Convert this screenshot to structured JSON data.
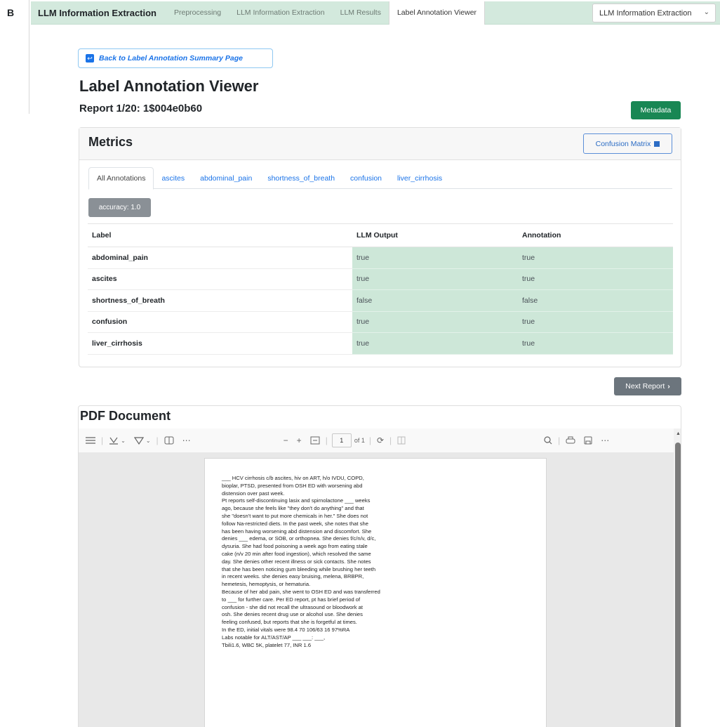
{
  "figure_label": "B",
  "nav": {
    "brand": "LLM Information Extraction",
    "tabs": [
      "Preprocessing",
      "LLM Information Extraction",
      "LLM Results",
      "Label Annotation Viewer"
    ],
    "active_tab": "Label Annotation Viewer",
    "select_value": "LLM Information Extraction"
  },
  "back_button": "Back to Label Annotation Summary Page",
  "page_title": "Label Annotation Viewer",
  "report_line": "Report 1/20: 1$004e0b60",
  "metadata_button": "Metadata",
  "metrics": {
    "title": "Metrics",
    "confusion_button": "Confusion Matrix",
    "tabs": [
      "All Annotations",
      "ascites",
      "abdominal_pain",
      "shortness_of_breath",
      "confusion",
      "liver_cirrhosis"
    ],
    "accuracy": "accuracy: 1.0",
    "columns": [
      "Label",
      "LLM Output",
      "Annotation"
    ],
    "rows": [
      {
        "label": "abdominal_pain",
        "llm": "true",
        "annotation": "true"
      },
      {
        "label": "ascites",
        "llm": "true",
        "annotation": "true"
      },
      {
        "label": "shortness_of_breath",
        "llm": "false",
        "annotation": "false"
      },
      {
        "label": "confusion",
        "llm": "true",
        "annotation": "true"
      },
      {
        "label": "liver_cirrhosis",
        "llm": "true",
        "annotation": "true"
      }
    ]
  },
  "next_button": "Next Report",
  "pdf": {
    "title": "PDF Document",
    "page_number": "1",
    "page_of": "of 1",
    "lines": [
      "___ HCV cirrhosis c/b ascites, hiv on ART, h/o IVDU, COPD,",
      "bioplar, PTSD, presented from OSH ED with worsening abd",
      "distension over past week.",
      "Pt reports self-discontinuing lasix and spirnolactone ___ weeks",
      "ago, because she feels like \"they don't do anything\" and that",
      "she \"doesn't want to put more chemicals in her.\" She does not",
      "follow Na-restricted diets. In the past week, she notes that she",
      "has been having worsening abd distension and discomfort. She",
      "denies ___ edema, or SOB, or orthopnea. She denies f/c/n/v, d/c,",
      "dysuria. She had food poisoning a week ago from eating stale",
      "cake (n/v 20 min after food ingestion), which resolved the same",
      "day. She denies other recent illness or sick contacts. She notes",
      "that she has been noticing gum bleeding while brushing her teeth",
      "in recent weeks. she denies easy bruising, melena, BRBPR,",
      "hemetesis, hemoptysis, or hematuria.",
      "Because of her abd pain, she went to OSH ED and was transferred",
      "to ___ for further care. Per ED report, pt has brief period of",
      "confusion - she did not recall the ultrasound or bloodwork at",
      "osh. She denies recent drug use or alcohol use. She denies",
      "feeling confused, but reports that she is forgetful at times.",
      "In the ED, initial vitals were 98.4 70 106/63 16 97%RA",
      "Labs notable for ALT/AST/AP ___ ___: ___,",
      "Tbili1.6, WBC 5K, platelet 77, INR 1.6"
    ]
  },
  "colors": {
    "nav_bg": "#d3e9dd",
    "match_cell": "#cde7d8",
    "metadata_button": "#198754",
    "link": "#1a73e8",
    "accuracy_badge": "#8a9096",
    "next_button": "#6c757d"
  },
  "icons": [
    "back-arrow-icon",
    "grid-icon",
    "chevron-down-icon",
    "chevron-right-icon",
    "toc-icon",
    "highlight-icon",
    "draw-icon",
    "view-icon",
    "more-icon",
    "zoom-out-icon",
    "zoom-in-icon",
    "fit-page-icon",
    "rotate-icon",
    "search-icon",
    "print-icon",
    "save-icon"
  ]
}
